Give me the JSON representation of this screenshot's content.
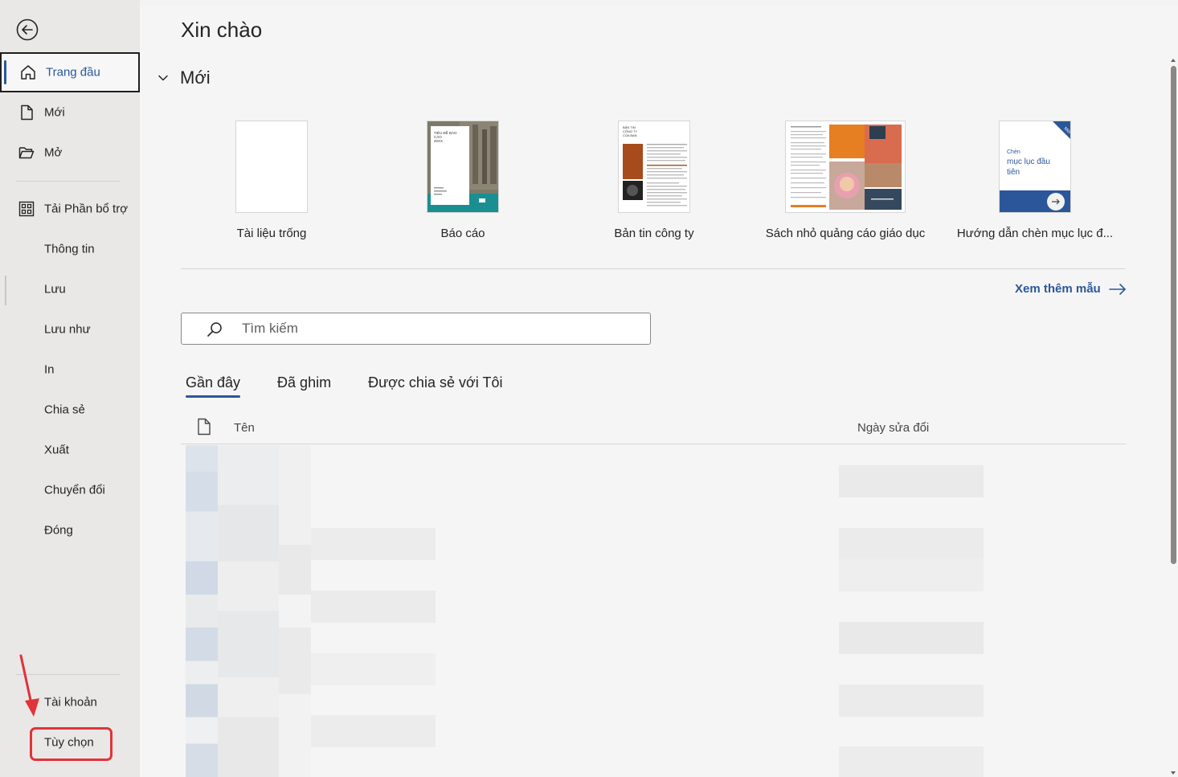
{
  "sidebar": {
    "back_label": "Back",
    "items": [
      {
        "label": "Trang đầu",
        "icon": "home-icon",
        "active": true
      },
      {
        "label": "Mới",
        "icon": "new-document-icon"
      },
      {
        "label": "Mở",
        "icon": "open-folder-icon"
      },
      {
        "label": "Tải Phần bổ trợ",
        "icon": "addins-grid-icon"
      },
      {
        "label": "Thông tin"
      },
      {
        "label": "Lưu"
      },
      {
        "label": "Lưu như"
      },
      {
        "label": "In"
      },
      {
        "label": "Chia sẻ"
      },
      {
        "label": "Xuất"
      },
      {
        "label": "Chuyển đổi"
      },
      {
        "label": "Đóng"
      }
    ],
    "bottom_items": [
      {
        "label": "Tài khoản"
      },
      {
        "label": "Tùy chọn",
        "highlighted": true
      }
    ]
  },
  "main": {
    "greeting": "Xin chào",
    "new_section": "Mới",
    "templates": [
      {
        "name": "Tài liệu trống"
      },
      {
        "name": "Báo cáo",
        "thumb_title": "TIÊU ĐỀ BÁO CÁO 20XX"
      },
      {
        "name": "Bản tin công ty",
        "thumb_title": "BẢN TIN CÔNG TY CỦA BẠN"
      },
      {
        "name": "Sách nhỏ quảng cáo giáo dục"
      },
      {
        "name": "Hướng dẫn chèn mục lục đ...",
        "thumb_text": "Chèn mục lục đầu tiên",
        "badge": "Mới"
      }
    ],
    "more_templates": "Xem thêm mẫu",
    "search": {
      "placeholder": "Tìm kiếm"
    },
    "tabs": [
      {
        "label": "Gần đây",
        "active": true
      },
      {
        "label": "Đã ghim"
      },
      {
        "label": "Được chia sẻ với Tôi"
      }
    ],
    "columns": {
      "name": "Tên",
      "modified": "Ngày sửa đổi"
    }
  },
  "colors": {
    "accent": "#2b579a",
    "highlight": "#e0333a",
    "sidebar_bg": "#e9e8e6",
    "main_bg": "#f5f5f5"
  }
}
